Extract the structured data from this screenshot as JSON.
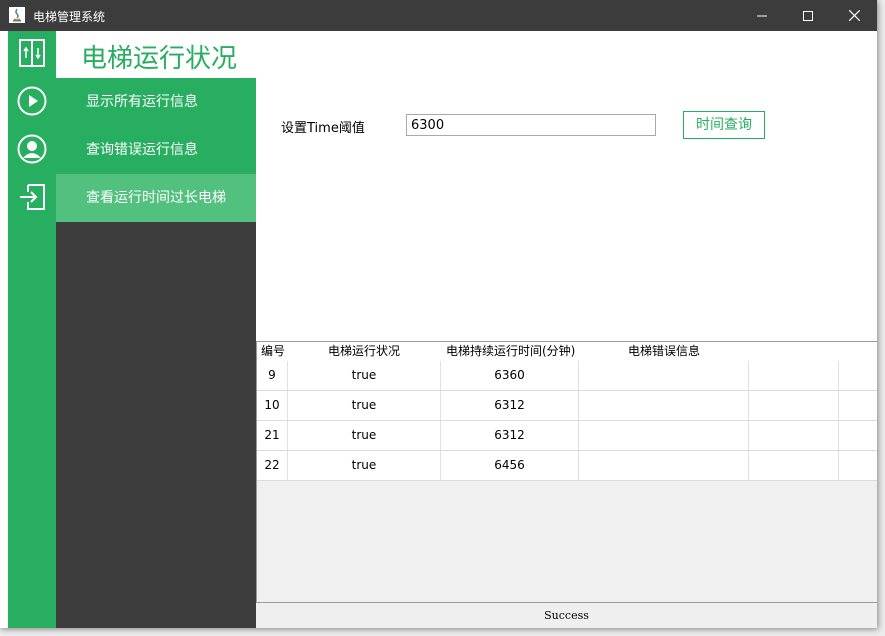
{
  "window": {
    "title": "电梯管理系统"
  },
  "header": {
    "title": "电梯运行状况"
  },
  "sidebar": {
    "icons": [
      "elevator-icon",
      "play-icon",
      "user-icon",
      "logout-icon"
    ],
    "items": [
      {
        "label": "显示所有运行信息"
      },
      {
        "label": "查询错误运行信息"
      },
      {
        "label": "查看运行时间过长电梯"
      }
    ]
  },
  "form": {
    "label": "设置Time阈值",
    "value": "6300",
    "button": "时间查询"
  },
  "table": {
    "columns": [
      "编号",
      "电梯运行状况",
      "电梯持续运行时间(分钟)",
      "电梯错误信息"
    ],
    "rows": [
      [
        "9",
        "true",
        "6360",
        ""
      ],
      [
        "10",
        "true",
        "6312",
        ""
      ],
      [
        "21",
        "true",
        "6312",
        ""
      ],
      [
        "22",
        "true",
        "6456",
        ""
      ]
    ]
  },
  "status": {
    "text": "Success"
  },
  "colors": {
    "accent": "#27ae60",
    "menu_bg": "#3d3d3d",
    "active_item": "#52c07f",
    "titlebar": "#3c3c3c"
  }
}
